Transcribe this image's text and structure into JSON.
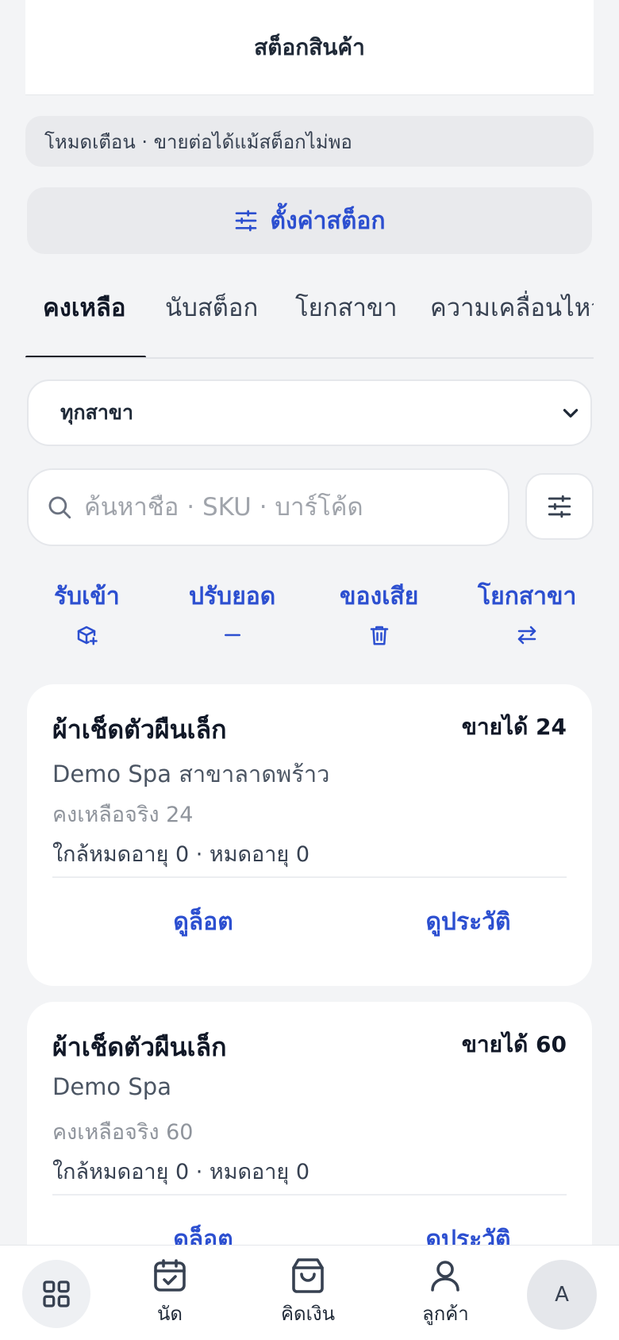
{
  "header": {
    "title": "สต็อกสินค้า"
  },
  "mode_banner": {
    "text": "โหมดเตือน · ขายต่อได้แม้สต็อกไม่พอ"
  },
  "settings_button": {
    "label": "ตั้งค่าสต็อก",
    "icon": "sliders-icon"
  },
  "tabs": [
    {
      "label": "คงเหลือ",
      "active": true
    },
    {
      "label": "นับสต็อก",
      "active": false
    },
    {
      "label": "โยกสาขา",
      "active": false
    },
    {
      "label": "ความเคลื่อนไหว",
      "active": false
    }
  ],
  "branch_select": {
    "value": "ทุกสาขา"
  },
  "search": {
    "placeholder": "ค้นหาชื่อ · SKU · บาร์โค้ด",
    "value": ""
  },
  "actions": [
    {
      "label": "รับเข้า",
      "icon": "box-plus-icon"
    },
    {
      "label": "ปรับยอด",
      "icon": "minus-icon"
    },
    {
      "label": "ของเสีย",
      "icon": "trash-icon"
    },
    {
      "label": "โยกสาขา",
      "icon": "transfer-arrows-icon"
    }
  ],
  "items": [
    {
      "name": "ผ้าเช็ดตัวผืนเล็ก",
      "available": "ขายได้ 24",
      "branch": "Demo Spa สาขาลาดพร้าว",
      "remaining": "คงเหลือจริง 24",
      "expiry": "ใกล้หมดอายุ 0 · หมดอายุ 0",
      "lots_label": "ดูล็อต",
      "history_label": "ดูประวัติ"
    },
    {
      "name": "ผ้าเช็ดตัวผืนเล็ก",
      "available": "ขายได้ 60",
      "branch": "Demo Spa",
      "remaining": "คงเหลือจริง 60",
      "expiry": "ใกล้หมดอายุ 0 · หมดอายุ 0",
      "lots_label": "ดูล็อต",
      "history_label": "ดูประวัติ"
    }
  ],
  "bottom_nav": {
    "home_icon": "grid-icon",
    "items": [
      {
        "label": "นัด",
        "icon": "calendar-check-icon"
      },
      {
        "label": "คิดเงิน",
        "icon": "shopping-bag-icon"
      },
      {
        "label": "ลูกค้า",
        "icon": "user-icon"
      }
    ],
    "avatar": "A"
  },
  "colors": {
    "accent": "#2c4fd0",
    "background": "#f3f4f6",
    "card": "#ffffff"
  }
}
